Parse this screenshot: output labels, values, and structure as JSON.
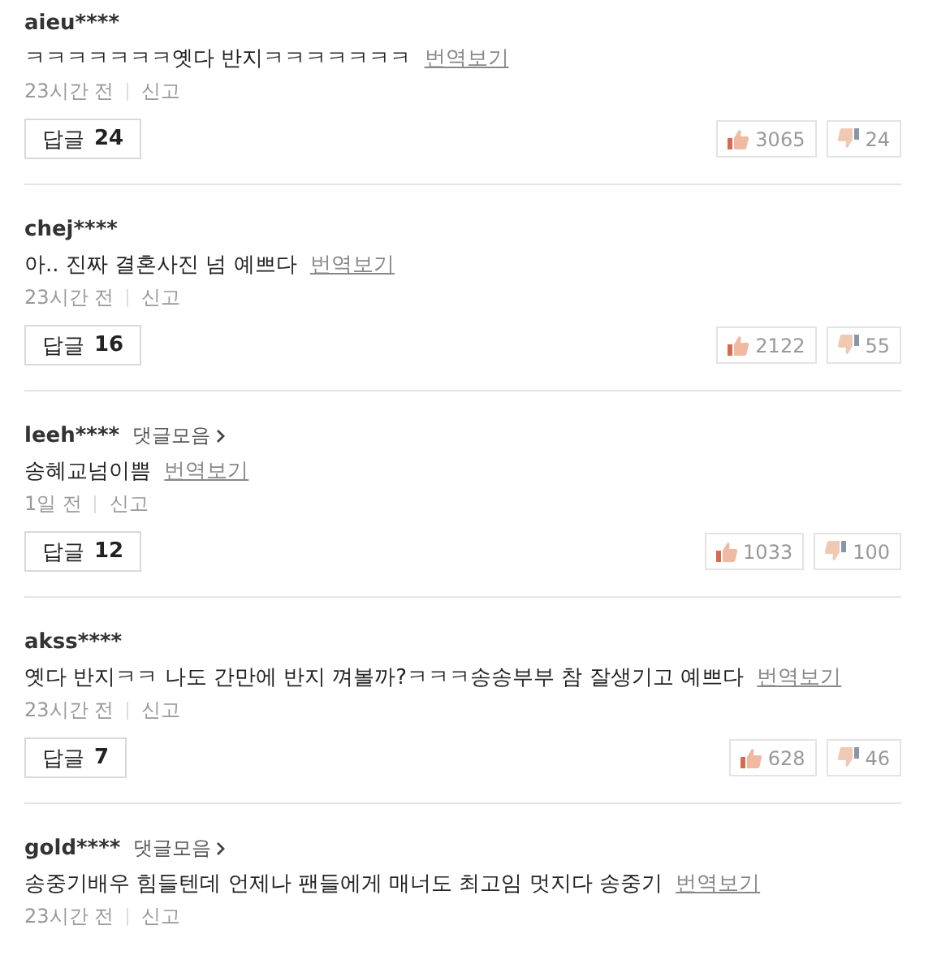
{
  "comments": [
    {
      "user": "aieu****",
      "text": "ㅋㅋㅋㅋㅋㅋㅋ옛다 반지ㅋㅋㅋㅋㅋㅋㅋ",
      "translate": "번역보기",
      "time": "23시간 전",
      "report": "신고",
      "reply_label": "답글",
      "reply_count": "24",
      "likes": "3065",
      "dislikes": "24"
    },
    {
      "user": "chej****",
      "text": "아.. 진짜 결혼사진 넘 예쁘다",
      "translate": "번역보기",
      "time": "23시간 전",
      "report": "신고",
      "reply_label": "답글",
      "reply_count": "16",
      "likes": "2122",
      "dislikes": "55"
    },
    {
      "user": "leeh****",
      "collect": "댓글모음",
      "text": "송혜교넘이쁨",
      "translate": "번역보기",
      "time": "1일 전",
      "report": "신고",
      "reply_label": "답글",
      "reply_count": "12",
      "likes": "1033",
      "dislikes": "100"
    },
    {
      "user": "akss****",
      "text": "옛다 반지ㅋㅋ 나도 간만에 반지 껴볼까?ㅋㅋㅋ송송부부 참 잘생기고 예쁘다",
      "translate": "번역보기",
      "time": "23시간 전",
      "report": "신고",
      "reply_label": "답글",
      "reply_count": "7",
      "likes": "628",
      "dislikes": "46"
    },
    {
      "user": "gold****",
      "collect": "댓글모음",
      "text": "송중기배우 힘들텐데 언제나 팬들에게 매너도 최고임 멋지다 송중기",
      "translate": "번역보기",
      "time": "23시간 전",
      "report": "신고"
    }
  ]
}
